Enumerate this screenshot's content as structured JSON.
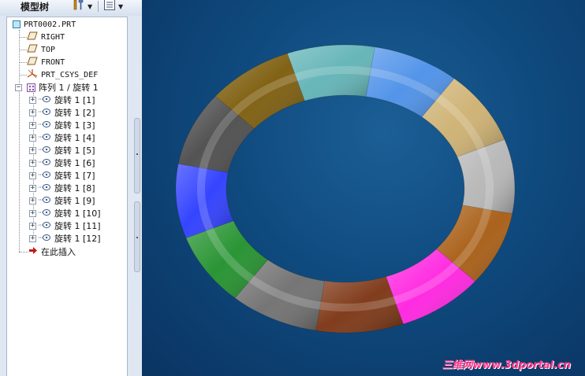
{
  "header": {
    "title": "模型树",
    "buttons": [
      {
        "name": "settings",
        "icon": "tools-icon",
        "has_dropdown": true
      },
      {
        "name": "show",
        "icon": "list-icon",
        "has_dropdown": true
      }
    ]
  },
  "tree": {
    "root": {
      "label": "PRT0002.PRT",
      "icon": "part-icon"
    },
    "datums": [
      {
        "label": "RIGHT",
        "icon": "datum-plane-icon"
      },
      {
        "label": "TOP",
        "icon": "datum-plane-icon"
      },
      {
        "label": "FRONT",
        "icon": "datum-plane-icon"
      },
      {
        "label": "PRT_CSYS_DEF",
        "icon": "coordinate-system-icon"
      }
    ],
    "pattern": {
      "label": "阵列 1 / 旋转 1",
      "expanded": true,
      "icon": "pattern-icon"
    },
    "children": [
      "旋转 1 [1]",
      "旋转 1 [2]",
      "旋转 1 [3]",
      "旋转 1 [4]",
      "旋转 1 [5]",
      "旋转 1 [6]",
      "旋转 1 [7]",
      "旋转 1 [8]",
      "旋转 1 [9]",
      "旋转 1 [10]",
      "旋转 1 [11]",
      "旋转 1 [12]"
    ],
    "insert_here": {
      "label": "在此插入",
      "icon": "insert-arrow-icon"
    }
  },
  "viewport": {
    "segment_colors": [
      "#1f8f2a",
      "#2a3bff",
      "#4a4a4a",
      "#7b5a08",
      "#5fb2b5",
      "#4a8fe8",
      "#cdb070",
      "#b5b5b5",
      "#a65a10",
      "#ff20e0",
      "#7a3210",
      "#6e6e6e"
    ],
    "background": "#0f4a7e"
  },
  "watermark": "三维网www.3dportal.cn"
}
